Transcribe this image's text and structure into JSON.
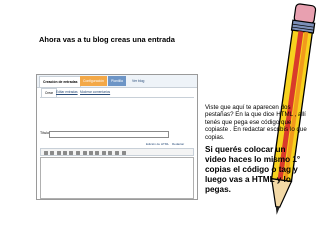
{
  "slide": {
    "title": "Ahora vas a tu blog creas una entrada",
    "note_small": "Viste que aquí te aparecen dos pestañas? En la que dice HTML , allí tenés que pega ese código que copiaste . En redactar escribís lo que copias.",
    "note_big": "Si querés colocar un video haces lo mismo 1° copias el código o tag y luego vas a HTML y lo pegas."
  },
  "screenshot": {
    "tabs": [
      "Creación de entradas",
      "Configuración",
      "Plantilla",
      "Ver blog"
    ],
    "subtabs": [
      "Crear",
      "Editar entradas",
      "Moderar comentarios"
    ],
    "title_label": "Título",
    "editor_tabs": [
      "Edición de HTML",
      "Redactar"
    ]
  },
  "colors": {
    "tab_orange": "#f3a847",
    "tab_blue": "#6d95c6",
    "link_blue": "#2a4d7a"
  },
  "icons": [
    "pencil-clipart-icon"
  ]
}
